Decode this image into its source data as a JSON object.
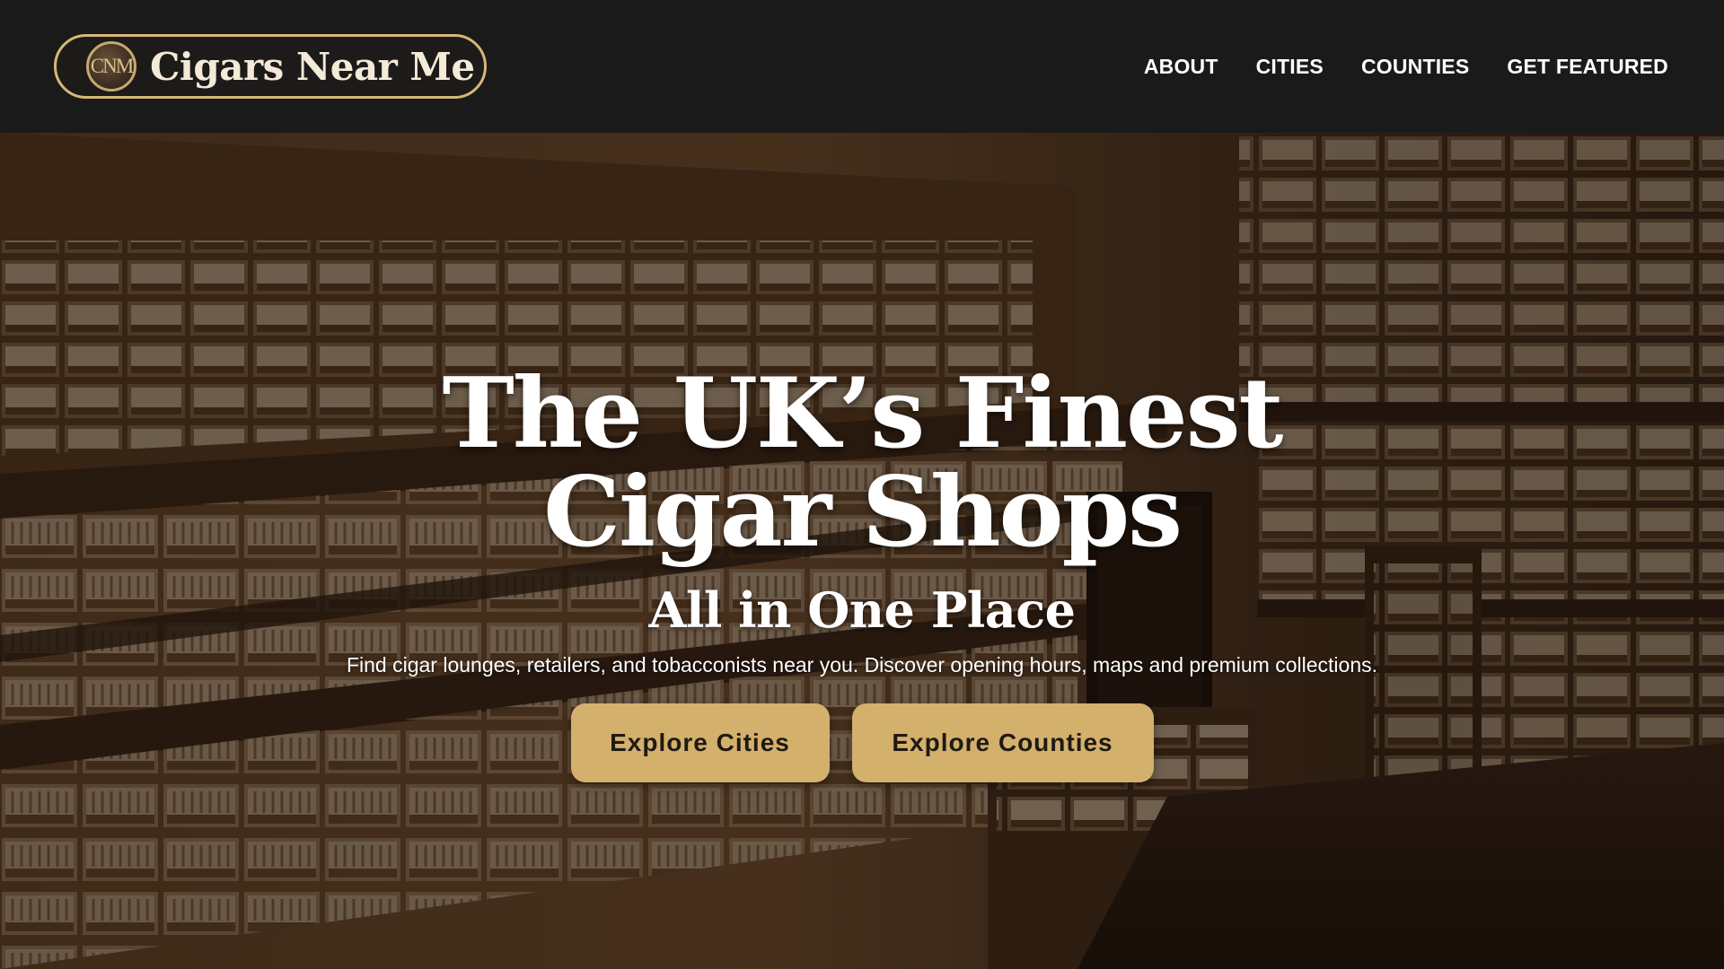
{
  "header": {
    "logo_mark": "CNM",
    "logo_text": "Cigars Near Me",
    "nav": [
      {
        "label": "ABOUT"
      },
      {
        "label": "CITIES"
      },
      {
        "label": "COUNTIES"
      },
      {
        "label": "GET FEATURED"
      }
    ]
  },
  "hero": {
    "title": "The UK’s Finest Cigar Shops",
    "subtitle": "All in One Place",
    "description": "Find cigar lounges, retailers, and tobacconists near you. Discover opening hours, maps and premium collections.",
    "buttons": {
      "cities": "Explore Cities",
      "counties": "Explore Counties"
    },
    "background_image": "cigar-shop-shelves-photo"
  },
  "colors": {
    "header_bg": "#1b1a1a",
    "accent_gold": "#d3b06c",
    "text_white": "#ffffff"
  }
}
